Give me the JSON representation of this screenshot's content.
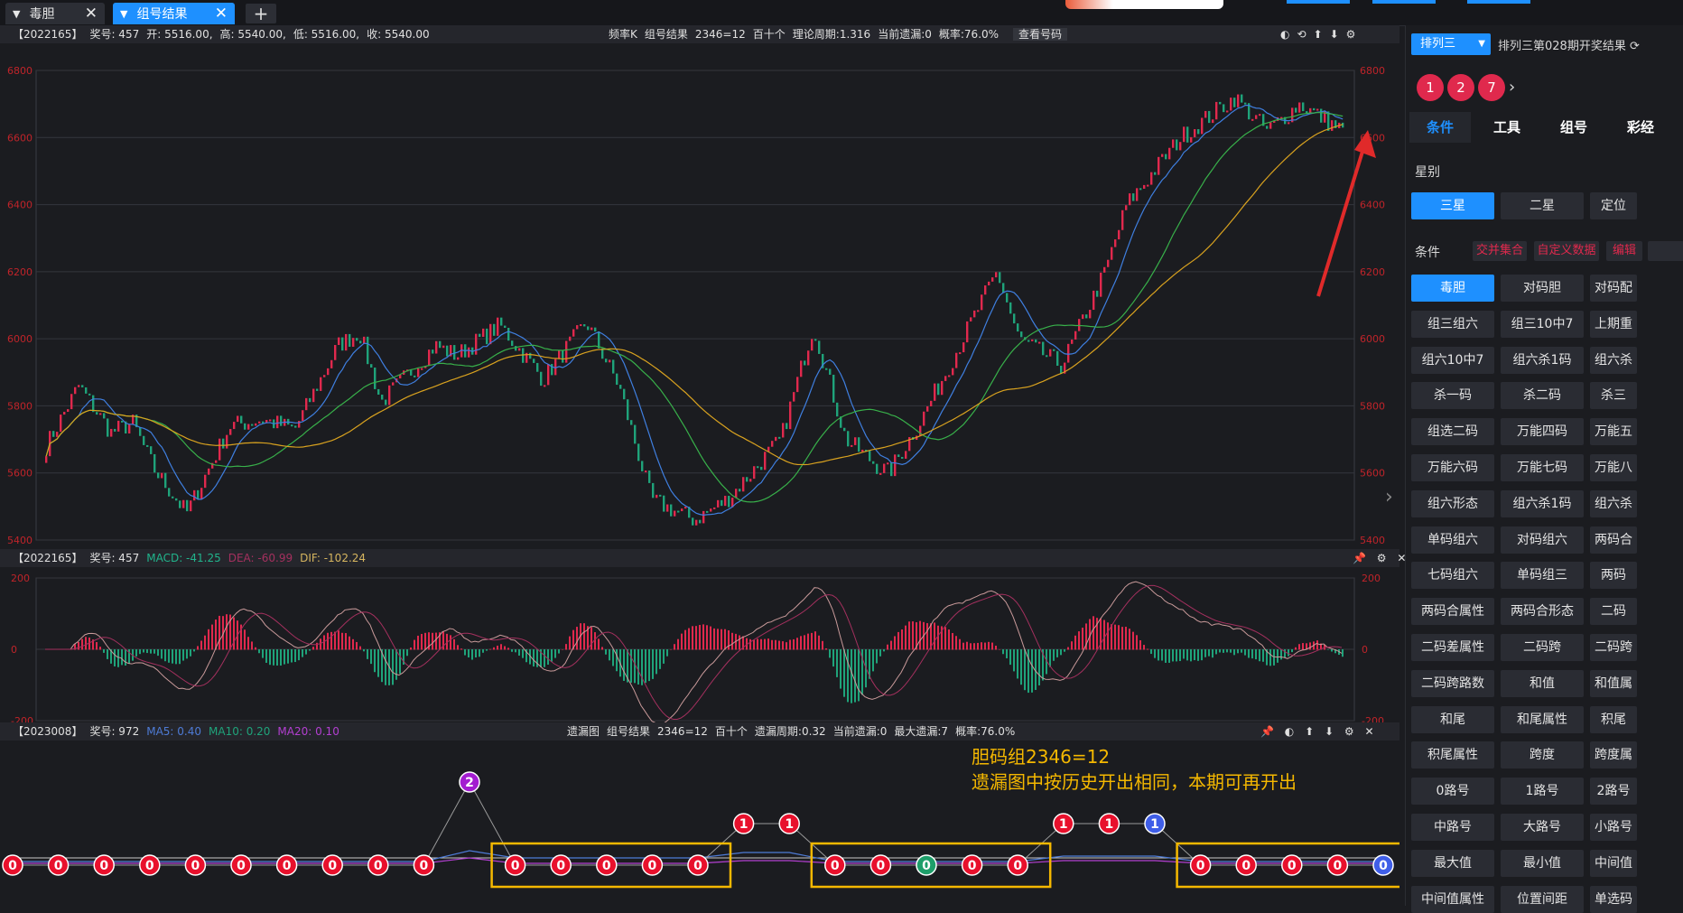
{
  "tabs": [
    {
      "label": "毒胆",
      "active": false
    },
    {
      "label": "组号结果",
      "active": true
    }
  ],
  "add_tab": "+",
  "panel1": {
    "id": "【2022165】",
    "award": "奖号: 457",
    "open": "开: 5516.00,",
    "high": "高: 5540.00,",
    "low": "低: 5516.00,",
    "close": "收: 5540.00",
    "kind": "频率K",
    "result": "组号结果",
    "group": "2346=12",
    "pos": "百十个",
    "period": "理论周期:1.316",
    "miss": "当前遗漏:0",
    "prob": "概率:76.0%",
    "view": "查看号码",
    "yticks": [
      "6800",
      "6600",
      "6400",
      "6200",
      "6000",
      "5800",
      "5600",
      "5400"
    ]
  },
  "panel2": {
    "id": "【2022165】",
    "award": "奖号: 457",
    "macd": "MACD: -41.25",
    "dea": "DEA: -60.99",
    "dif": "DIF: -102.24",
    "yticks": [
      "200",
      "0",
      "-200"
    ]
  },
  "panel3": {
    "id": "【2023008】",
    "award": "奖号: 972",
    "ma5": "MA5: 0.40",
    "ma10": "MA10: 0.20",
    "ma20": "MA20: 0.10",
    "kind": "遗漏图",
    "result": "组号结果",
    "group": "2346=12",
    "pos": "百十个",
    "period": "遗漏周期:0.32",
    "miss": "当前遗漏:0",
    "maxmiss": "最大遗漏:7",
    "prob": "概率:76.0%"
  },
  "annotation": {
    "line1": "胆码组2346=12",
    "line2": "遗漏图中按历史开出相同，本期可再开出"
  },
  "omission_nodes": [
    {
      "v": "0",
      "c": "red",
      "lvl": 0
    },
    {
      "v": "0",
      "c": "red",
      "lvl": 0
    },
    {
      "v": "0",
      "c": "red",
      "lvl": 0
    },
    {
      "v": "0",
      "c": "red",
      "lvl": 0
    },
    {
      "v": "0",
      "c": "red",
      "lvl": 0
    },
    {
      "v": "0",
      "c": "red",
      "lvl": 0
    },
    {
      "v": "0",
      "c": "red",
      "lvl": 0
    },
    {
      "v": "0",
      "c": "red",
      "lvl": 0
    },
    {
      "v": "0",
      "c": "red",
      "lvl": 0
    },
    {
      "v": "0",
      "c": "red",
      "lvl": 0
    },
    {
      "v": "2",
      "c": "purple",
      "lvl": 2
    },
    {
      "v": "0",
      "c": "red",
      "lvl": 0
    },
    {
      "v": "0",
      "c": "red",
      "lvl": 0
    },
    {
      "v": "0",
      "c": "red",
      "lvl": 0
    },
    {
      "v": "0",
      "c": "red",
      "lvl": 0
    },
    {
      "v": "0",
      "c": "red",
      "lvl": 0
    },
    {
      "v": "1",
      "c": "red",
      "lvl": 1
    },
    {
      "v": "1",
      "c": "red",
      "lvl": 1
    },
    {
      "v": "0",
      "c": "red",
      "lvl": 0
    },
    {
      "v": "0",
      "c": "red",
      "lvl": 0
    },
    {
      "v": "0",
      "c": "green",
      "lvl": 0
    },
    {
      "v": "0",
      "c": "red",
      "lvl": 0
    },
    {
      "v": "0",
      "c": "red",
      "lvl": 0
    },
    {
      "v": "1",
      "c": "red",
      "lvl": 1
    },
    {
      "v": "1",
      "c": "red",
      "lvl": 1
    },
    {
      "v": "1",
      "c": "blue",
      "lvl": 1
    },
    {
      "v": "0",
      "c": "red",
      "lvl": 0
    },
    {
      "v": "0",
      "c": "red",
      "lvl": 0
    },
    {
      "v": "0",
      "c": "red",
      "lvl": 0
    },
    {
      "v": "0",
      "c": "red",
      "lvl": 0
    },
    {
      "v": "0",
      "c": "blue",
      "lvl": 0
    }
  ],
  "colors": {
    "up": "#e0294d",
    "down": "#1fa37a",
    "accent": "#1e90ff",
    "annot": "#f5b800",
    "arrow": "#e02a2a"
  },
  "sidebar": {
    "lottery_select": "排列三",
    "result_title": "排列三第028期开奖结果",
    "balls": [
      "1",
      "2",
      "7"
    ],
    "nav": [
      "条件",
      "工具",
      "组号",
      "彩经"
    ],
    "star_label": "星别",
    "stars": [
      "三星",
      "二星",
      "定位"
    ],
    "cond_label": "条件",
    "chips": [
      "交并集合",
      "自定义数据",
      "编辑"
    ],
    "buttons": [
      [
        "毒胆",
        "对码胆",
        "对码配"
      ],
      [
        "组三组六",
        "组三10中7",
        "上期重"
      ],
      [
        "组六10中7",
        "组六杀1码",
        "组六杀"
      ],
      [
        "杀一码",
        "杀二码",
        "杀三"
      ],
      [
        "组选二码",
        "万能四码",
        "万能五"
      ],
      [
        "万能六码",
        "万能七码",
        "万能八"
      ],
      [
        "组六形态",
        "组六杀1码",
        "组六杀"
      ],
      [
        "单码组六",
        "对码组六",
        "两码合"
      ],
      [
        "七码组六",
        "单码组三",
        "两码"
      ],
      [
        "两码合属性",
        "两码合形态",
        "二码"
      ],
      [
        "二码差属性",
        "二码跨",
        "二码跨"
      ],
      [
        "二码跨路数",
        "和值",
        "和值属"
      ],
      [
        "和尾",
        "和尾属性",
        "积尾"
      ],
      [
        "积尾属性",
        "跨度",
        "跨度属"
      ],
      [
        "0路号",
        "1路号",
        "2路号"
      ],
      [
        "中路号",
        "大路号",
        "小路号"
      ],
      [
        "最大值",
        "最小值",
        "中间值"
      ],
      [
        "中间值属性",
        "位置间距",
        "单选码"
      ]
    ]
  }
}
